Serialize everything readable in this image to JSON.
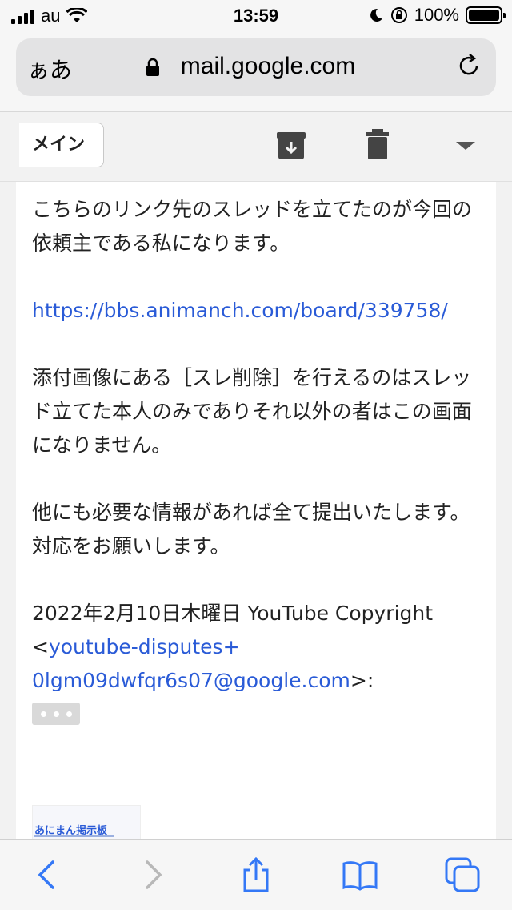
{
  "status_bar": {
    "carrier": "au",
    "time": "13:59",
    "battery_text": "100%"
  },
  "browser": {
    "aa_label": "ぁあ",
    "domain": "mail.google.com"
  },
  "mail_toolbar": {
    "back_label": "メイン",
    "icons": [
      "archive-icon",
      "trash-icon",
      "chevron-down-icon"
    ]
  },
  "message": {
    "para1": "こちらのリンク先のスレッドを立てたのが今回の依頼主である私になります。",
    "link": "https://bbs.animanch.com/board/339758/",
    "para2": "添付画像にある［スレ削除］を行えるのはスレッド立てた本人のみでありそれ以外の者はこの画面になりません。",
    "para3": "他にも必要な情報があれば全て提出いたします。対応をお願いします。",
    "quote_header": "2022年2月10日木曜日 YouTube Copyright",
    "quote_lt": "<",
    "quote_email_1": "youtube-disputes+",
    "quote_email_2": "0lgm09dwfqr6s07@google.com",
    "quote_gt": ">:",
    "thumb_title": "あにまん掲示板"
  },
  "bottom_bar": {
    "icons": [
      "back-icon",
      "forward-icon",
      "share-icon",
      "bookmarks-icon",
      "tabs-icon"
    ]
  },
  "colors": {
    "link": "#2a5bd7",
    "ios_blue": "#3478f6"
  }
}
